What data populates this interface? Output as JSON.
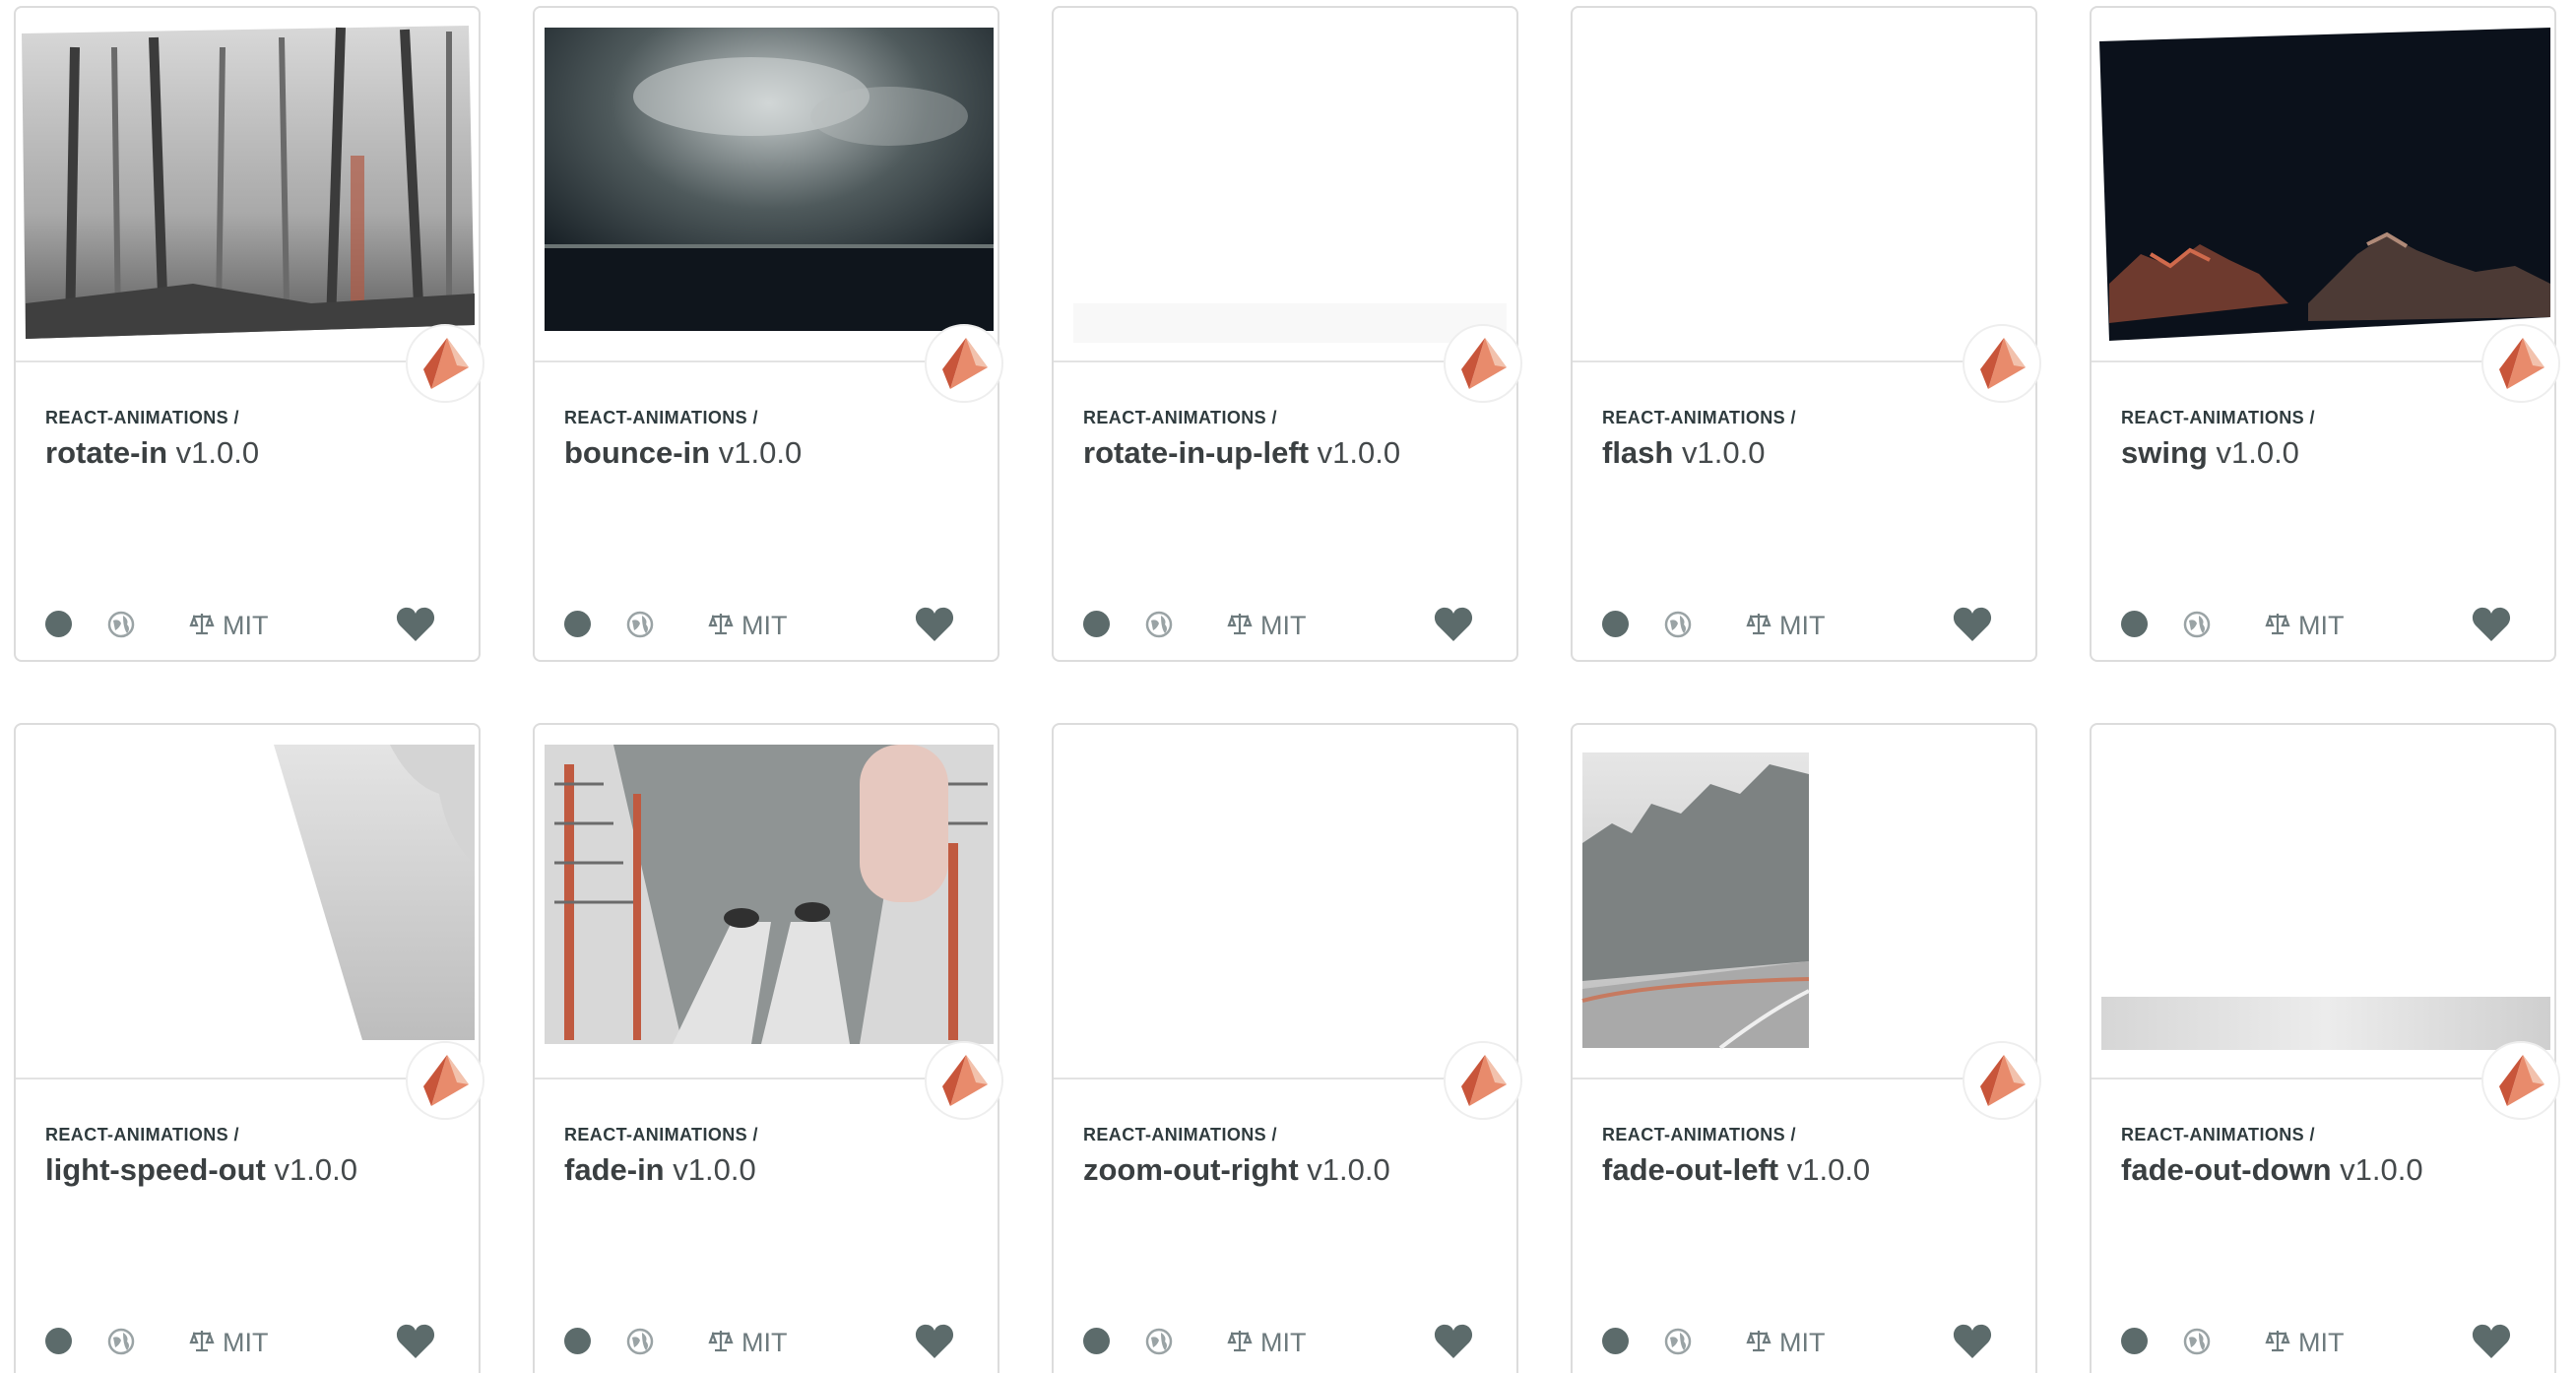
{
  "colors": {
    "accent": "#e06b4a",
    "icon_gray": "#5c6b6b",
    "border": "#dcdcdc"
  },
  "icons": {
    "logo": "diamond-logo-icon",
    "status": "status-dot-icon",
    "visibility": "globe-icon",
    "license": "scale-icon",
    "favorite": "heart-icon"
  },
  "cards": [
    {
      "scope": "REACT-ANIMATIONS /",
      "name": "rotate-in",
      "version": "v1.0.0",
      "license": "MIT"
    },
    {
      "scope": "REACT-ANIMATIONS /",
      "name": "bounce-in",
      "version": "v1.0.0",
      "license": "MIT"
    },
    {
      "scope": "REACT-ANIMATIONS /",
      "name": "rotate-in-up-left",
      "version": "v1.0.0",
      "license": "MIT"
    },
    {
      "scope": "REACT-ANIMATIONS /",
      "name": "flash",
      "version": "v1.0.0",
      "license": "MIT"
    },
    {
      "scope": "REACT-ANIMATIONS /",
      "name": "swing",
      "version": "v1.0.0",
      "license": "MIT"
    },
    {
      "scope": "REACT-ANIMATIONS /",
      "name": "light-speed-out",
      "version": "v1.0.0",
      "license": "MIT"
    },
    {
      "scope": "REACT-ANIMATIONS /",
      "name": "fade-in",
      "version": "v1.0.0",
      "license": "MIT"
    },
    {
      "scope": "REACT-ANIMATIONS /",
      "name": "zoom-out-right",
      "version": "v1.0.0",
      "license": "MIT"
    },
    {
      "scope": "REACT-ANIMATIONS /",
      "name": "fade-out-left",
      "version": "v1.0.0",
      "license": "MIT"
    },
    {
      "scope": "REACT-ANIMATIONS /",
      "name": "fade-out-down",
      "version": "v1.0.0",
      "license": "MIT"
    }
  ]
}
